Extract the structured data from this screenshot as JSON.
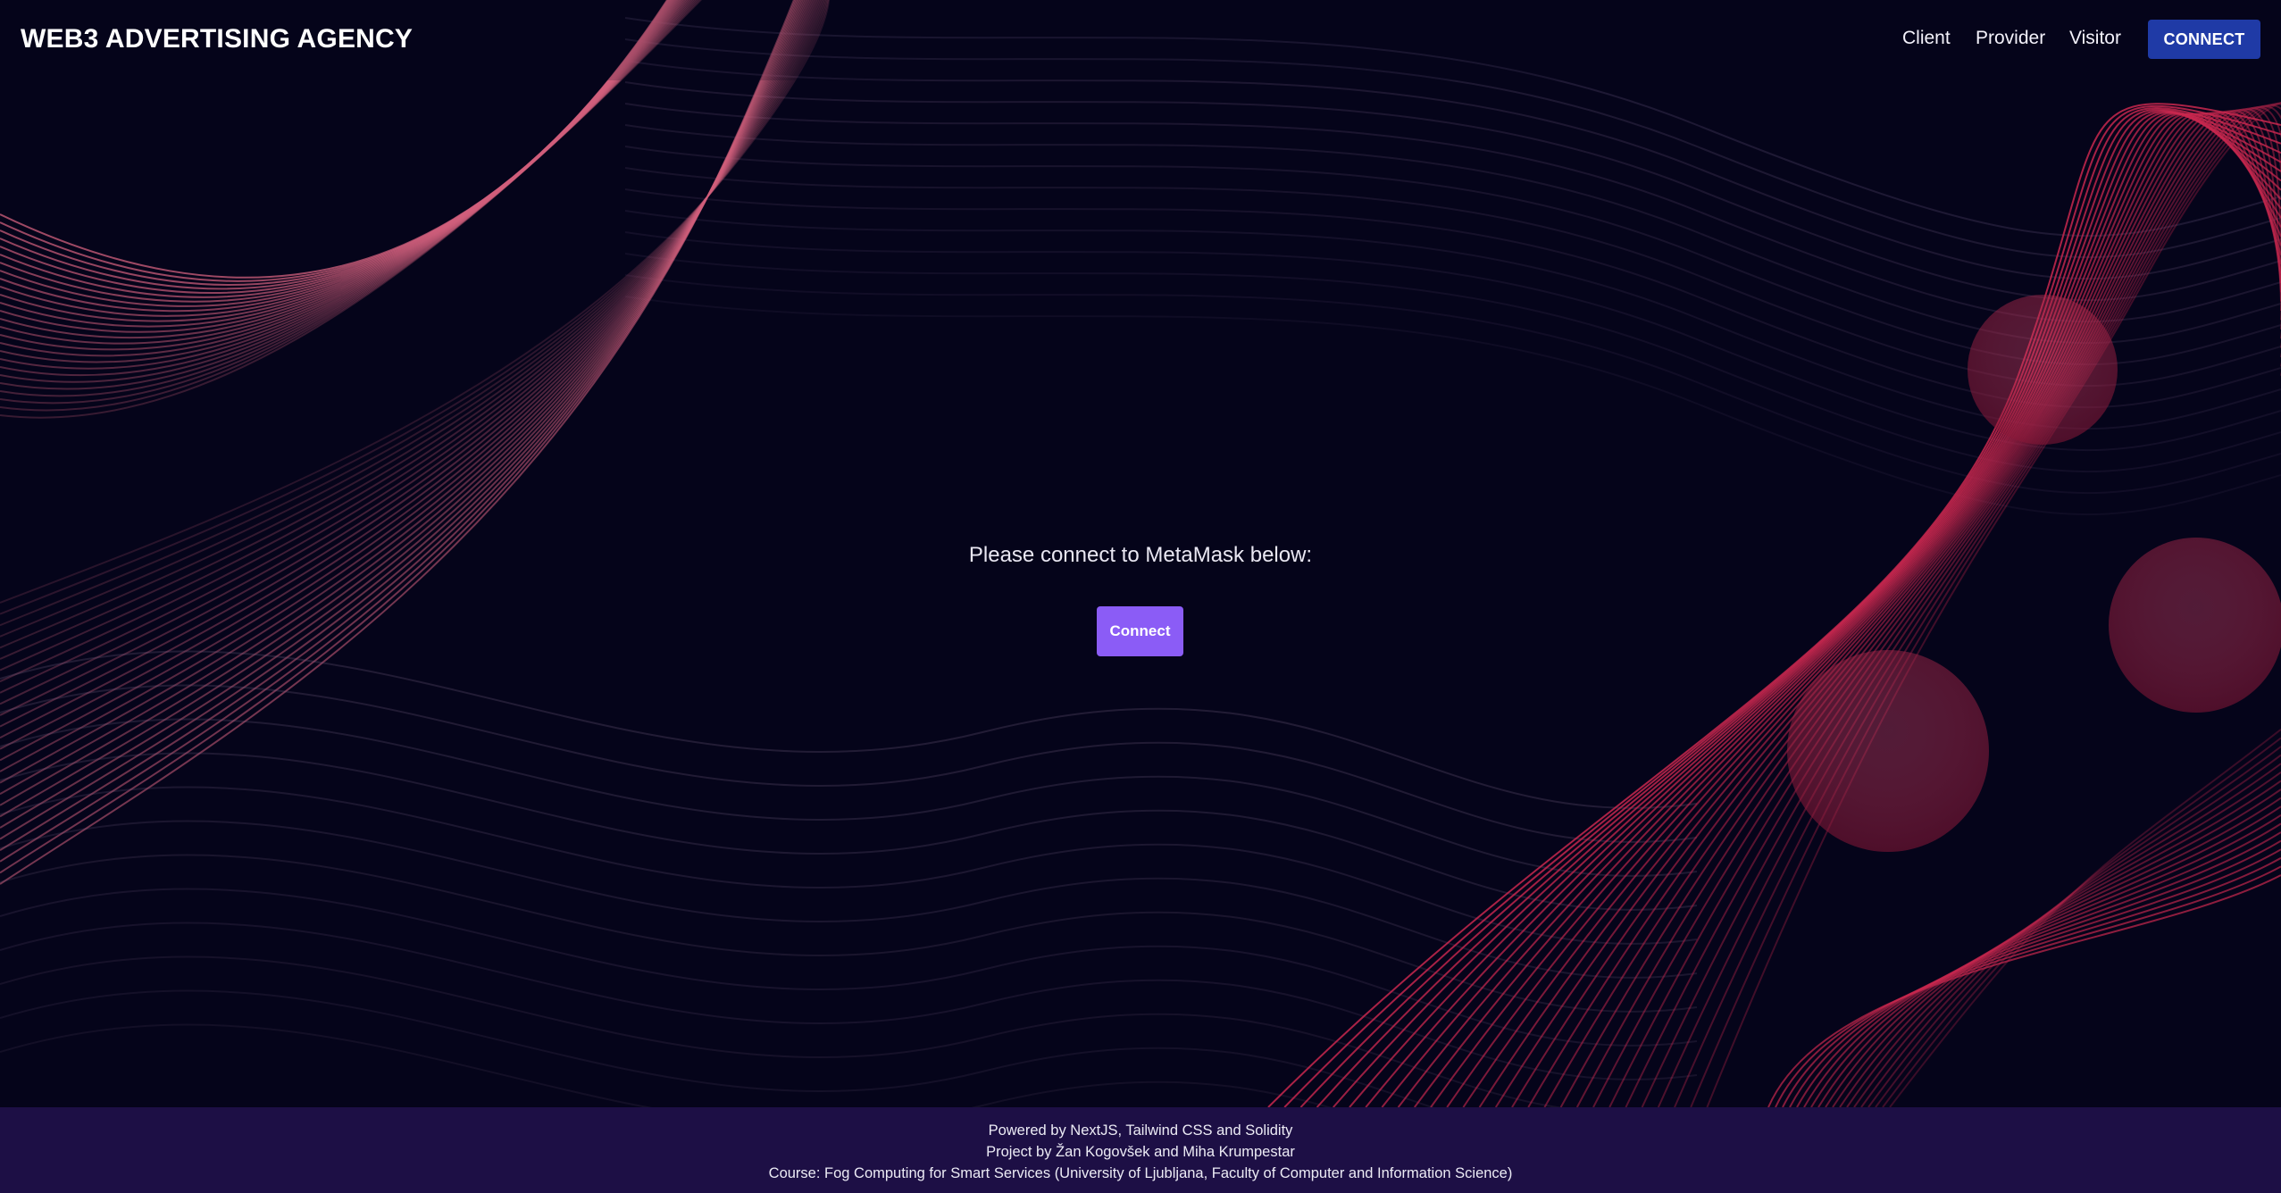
{
  "header": {
    "brand": "WEB3 ADVERTISING AGENCY",
    "nav": [
      {
        "label": "Client"
      },
      {
        "label": "Provider"
      },
      {
        "label": "Visitor"
      }
    ],
    "connect_label": "CONNECT"
  },
  "main": {
    "prompt": "Please connect to MetaMask below:",
    "connect_label": "Connect"
  },
  "footer": {
    "lines": [
      "Powered by NextJS, Tailwind CSS and Solidity",
      "Project by Žan Kogovšek and Miha Krumpestar",
      "Course: Fog Computing for Smart Services (University of Ljubljana, Faculty of Computer and Information Science)"
    ]
  },
  "colors": {
    "background": "#05041a",
    "header_button": "#1f3aa6",
    "primary_button": "#8b5cf6",
    "footer_background": "#1d0f45",
    "line_art_pink": "#d2607d",
    "line_art_crimson": "#c9284f"
  }
}
